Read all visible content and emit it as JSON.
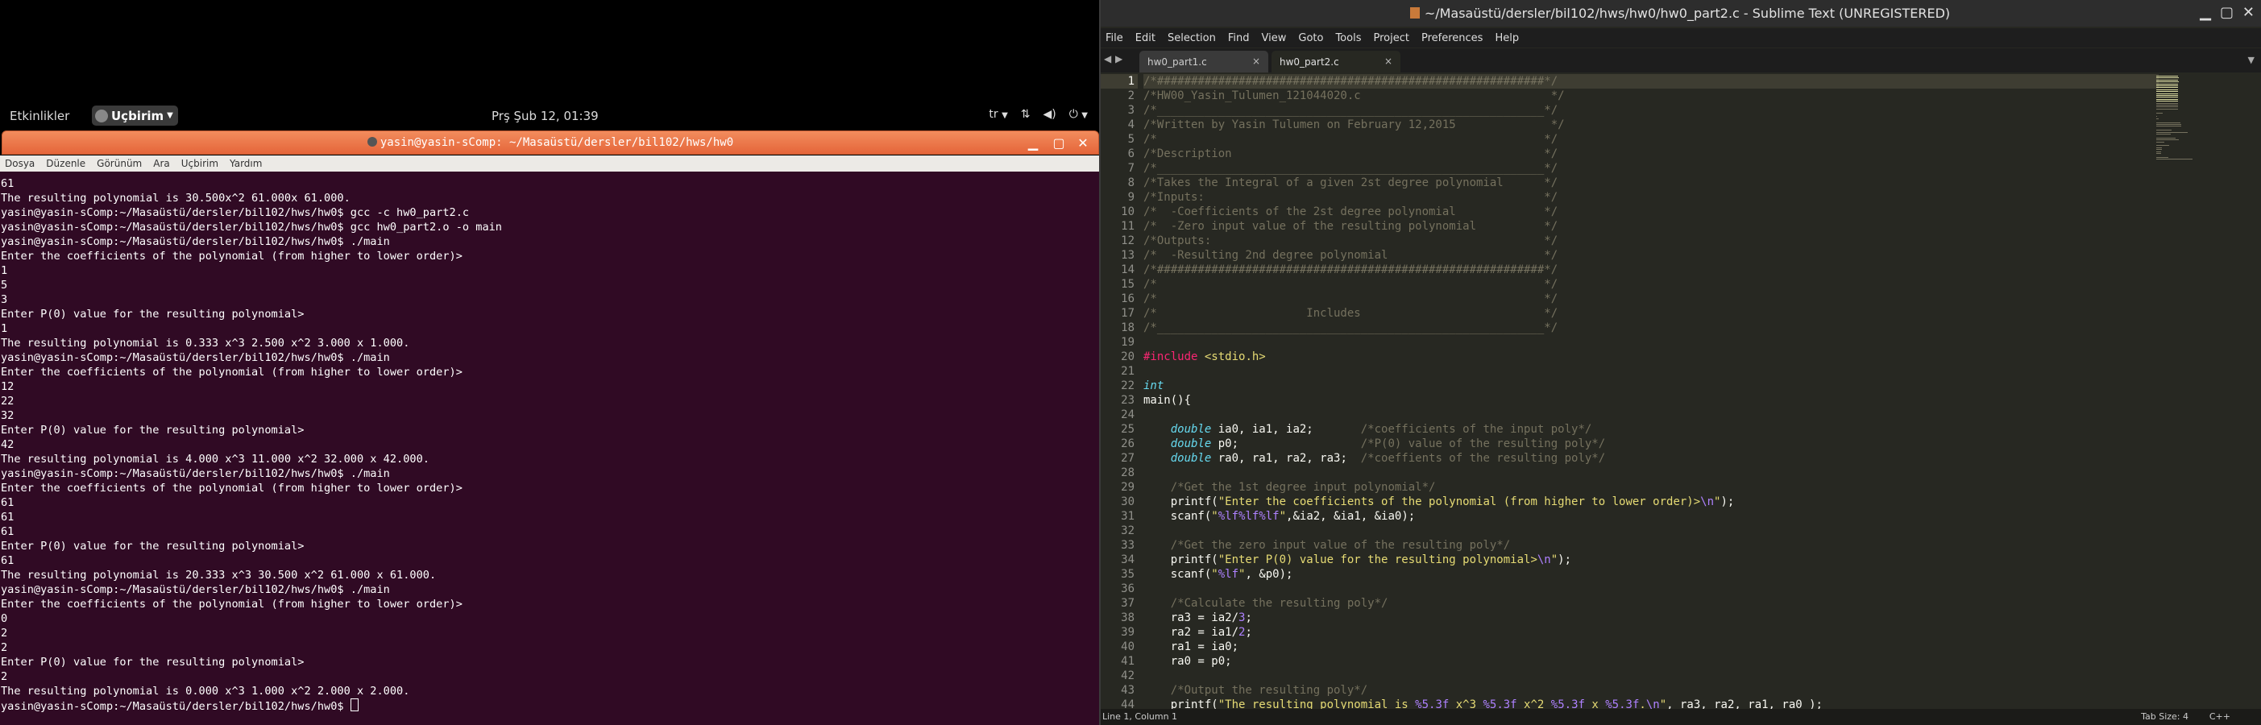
{
  "topbar": {
    "activities": "Etkinlikler",
    "apps": "Uçbirim",
    "clock": "Prş Şub 12, 01:39",
    "lang": "tr"
  },
  "terminal": {
    "title": "yasin@yasin-sComp: ~/Masaüstü/dersler/bil102/hws/hw0",
    "menu": [
      "Dosya",
      "Düzenle",
      "Görünüm",
      "Ara",
      "Uçbirim",
      "Yardım"
    ],
    "lines": [
      "61",
      "The resulting polynomial is 30.500x^2 61.000x 61.000.",
      "yasin@yasin-sComp:~/Masaüstü/dersler/bil102/hws/hw0$ gcc -c hw0_part2.c",
      "yasin@yasin-sComp:~/Masaüstü/dersler/bil102/hws/hw0$ gcc hw0_part2.o -o main",
      "yasin@yasin-sComp:~/Masaüstü/dersler/bil102/hws/hw0$ ./main",
      "Enter the coefficients of the polynomial (from higher to lower order)>",
      "1",
      "5",
      "3",
      "Enter P(0) value for the resulting polynomial>",
      "1",
      "The resulting polynomial is 0.333 x^3 2.500 x^2 3.000 x 1.000.",
      "yasin@yasin-sComp:~/Masaüstü/dersler/bil102/hws/hw0$ ./main",
      "Enter the coefficients of the polynomial (from higher to lower order)>",
      "12",
      "22",
      "32",
      "Enter P(0) value for the resulting polynomial>",
      "42",
      "The resulting polynomial is 4.000 x^3 11.000 x^2 32.000 x 42.000.",
      "yasin@yasin-sComp:~/Masaüstü/dersler/bil102/hws/hw0$ ./main",
      "Enter the coefficients of the polynomial (from higher to lower order)>",
      "61",
      "61",
      "61",
      "Enter P(0) value for the resulting polynomial>",
      "61",
      "The resulting polynomial is 20.333 x^3 30.500 x^2 61.000 x 61.000.",
      "yasin@yasin-sComp:~/Masaüstü/dersler/bil102/hws/hw0$ ./main",
      "Enter the coefficients of the polynomial (from higher to lower order)>",
      "0",
      "2",
      "2",
      "Enter P(0) value for the resulting polynomial>",
      "2",
      "The resulting polynomial is 0.000 x^3 1.000 x^2 2.000 x 2.000."
    ],
    "prompt": "yasin@yasin-sComp:~/Masaüstü/dersler/bil102/hws/hw0$ "
  },
  "sublime": {
    "title": "~/Masaüstü/dersler/bil102/hws/hw0/hw0_part2.c - Sublime Text (UNREGISTERED)",
    "menu": [
      "File",
      "Edit",
      "Selection",
      "Find",
      "View",
      "Goto",
      "Tools",
      "Project",
      "Preferences",
      "Help"
    ],
    "tabs": [
      {
        "label": "hw0_part1.c"
      },
      {
        "label": "hw0_part2.c"
      }
    ],
    "status_left": "Line 1, Column 1",
    "tab_size": "Tab Size: 4",
    "syntax": "C++",
    "code": [
      [
        [
          "c-com",
          "/*#########################################################*/"
        ]
      ],
      [
        [
          "c-com",
          "/*HW00_Yasin_Tulumen_121044020.c                            */"
        ]
      ],
      [
        [
          "c-com",
          "/*_________________________________________________________*/"
        ]
      ],
      [
        [
          "c-com",
          "/*Written by Yasin Tulumen on February 12,2015              */"
        ]
      ],
      [
        [
          "c-com",
          "/*                                                         */"
        ]
      ],
      [
        [
          "c-com",
          "/*Description                                              */"
        ]
      ],
      [
        [
          "c-com",
          "/*_________________________________________________________*/"
        ]
      ],
      [
        [
          "c-com",
          "/*Takes the Integral of a given 2st degree polynomial      */"
        ]
      ],
      [
        [
          "c-com",
          "/*Inputs:                                                  */"
        ]
      ],
      [
        [
          "c-com",
          "/*  -Coefficients of the 2st degree polynomial             */"
        ]
      ],
      [
        [
          "c-com",
          "/*  -Zero input value of the resulting polynomial          */"
        ]
      ],
      [
        [
          "c-com",
          "/*Outputs:                                                 */"
        ]
      ],
      [
        [
          "c-com",
          "/*  -Resulting 2nd degree polynomial                       */"
        ]
      ],
      [
        [
          "c-com",
          "/*#########################################################*/"
        ]
      ],
      [
        [
          "c-com",
          "/*                                                         */"
        ]
      ],
      [
        [
          "c-com",
          "/*                                                         */"
        ]
      ],
      [
        [
          "c-com",
          "/*                      Includes                           */"
        ]
      ],
      [
        [
          "c-com",
          "/*_________________________________________________________*/"
        ]
      ],
      [
        [
          "",
          ""
        ]
      ],
      [
        [
          "c-pre",
          "#include"
        ],
        [
          "",
          " "
        ],
        [
          "c-inc",
          "<stdio.h>"
        ]
      ],
      [
        [
          "",
          ""
        ]
      ],
      [
        [
          "c-type",
          "int"
        ]
      ],
      [
        [
          "",
          "main(){"
        ]
      ],
      [
        [
          "",
          ""
        ]
      ],
      [
        [
          "",
          "    "
        ],
        [
          "c-type",
          "double"
        ],
        [
          "",
          " ia0, ia1, ia2;       "
        ],
        [
          "c-com",
          "/*coefficients of the input poly*/"
        ]
      ],
      [
        [
          "",
          "    "
        ],
        [
          "c-type",
          "double"
        ],
        [
          "",
          " p0;                  "
        ],
        [
          "c-com",
          "/*P(0) value of the resulting poly*/"
        ]
      ],
      [
        [
          "",
          "    "
        ],
        [
          "c-type",
          "double"
        ],
        [
          "",
          " ra0, ra1, ra2, ra3;  "
        ],
        [
          "c-com",
          "/*coeffients of the resulting poly*/"
        ]
      ],
      [
        [
          "",
          ""
        ]
      ],
      [
        [
          "",
          "    "
        ],
        [
          "c-com",
          "/*Get the 1st degree input polynomial*/"
        ]
      ],
      [
        [
          "",
          "    printf("
        ],
        [
          "c-str",
          "\"Enter the coefficients of the polynomial (from higher to lower order)>"
        ],
        [
          "c-esc",
          "\\n"
        ],
        [
          "c-str",
          "\""
        ],
        [
          "",
          ");"
        ]
      ],
      [
        [
          "",
          "    scanf("
        ],
        [
          "c-str",
          "\""
        ],
        [
          "c-esc",
          "%lf%lf%lf"
        ],
        [
          "c-str",
          "\""
        ],
        [
          "",
          ",&ia2, &ia1, &ia0);"
        ]
      ],
      [
        [
          "",
          ""
        ]
      ],
      [
        [
          "",
          "    "
        ],
        [
          "c-com",
          "/*Get the zero input value of the resulting poly*/"
        ]
      ],
      [
        [
          "",
          "    printf("
        ],
        [
          "c-str",
          "\"Enter P(0) value for the resulting polynomial>"
        ],
        [
          "c-esc",
          "\\n"
        ],
        [
          "c-str",
          "\""
        ],
        [
          "",
          ");"
        ]
      ],
      [
        [
          "",
          "    scanf("
        ],
        [
          "c-str",
          "\""
        ],
        [
          "c-esc",
          "%lf"
        ],
        [
          "c-str",
          "\""
        ],
        [
          "",
          ", &p0);"
        ]
      ],
      [
        [
          "",
          ""
        ]
      ],
      [
        [
          "",
          "    "
        ],
        [
          "c-com",
          "/*Calculate the resulting poly*/"
        ]
      ],
      [
        [
          "",
          "    ra3 = ia2/"
        ],
        [
          "c-num",
          "3"
        ],
        [
          "",
          ";"
        ]
      ],
      [
        [
          "",
          "    ra2 = ia1/"
        ],
        [
          "c-num",
          "2"
        ],
        [
          "",
          ";"
        ]
      ],
      [
        [
          "",
          "    ra1 = ia0;"
        ]
      ],
      [
        [
          "",
          "    ra0 = p0;"
        ]
      ],
      [
        [
          "",
          ""
        ]
      ],
      [
        [
          "",
          "    "
        ],
        [
          "c-com",
          "/*Output the resulting poly*/"
        ]
      ],
      [
        [
          "",
          "    printf("
        ],
        [
          "c-str",
          "\"The resulting polynomial is "
        ],
        [
          "c-esc",
          "%5.3f"
        ],
        [
          "c-str",
          " x^3 "
        ],
        [
          "c-esc",
          "%5.3f"
        ],
        [
          "c-str",
          " x^2 "
        ],
        [
          "c-esc",
          "%5.3f"
        ],
        [
          "c-str",
          " x "
        ],
        [
          "c-esc",
          "%5.3f"
        ],
        [
          "c-str",
          "."
        ],
        [
          "c-esc",
          "\\n"
        ],
        [
          "c-str",
          "\""
        ],
        [
          "",
          ", ra3, ra2, ra1, ra0 );"
        ]
      ]
    ]
  }
}
